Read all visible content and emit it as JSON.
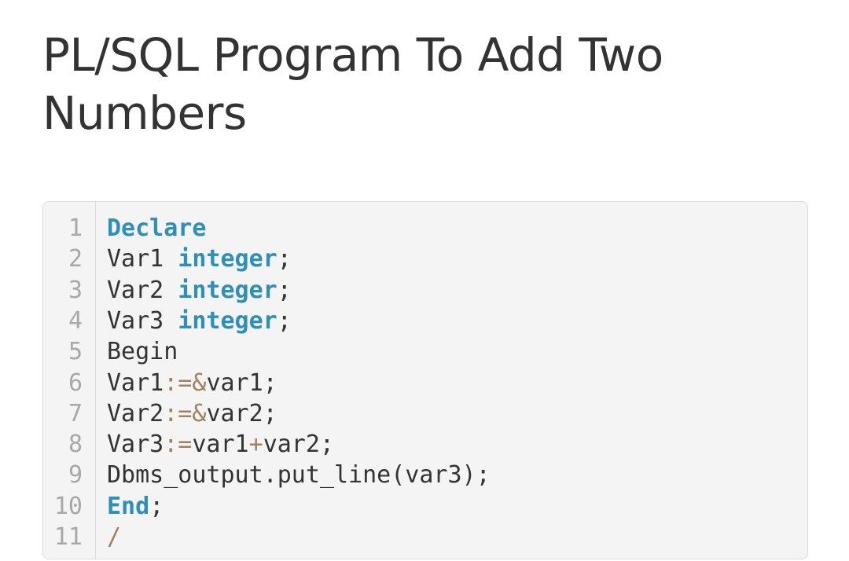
{
  "article": {
    "title_line1": "PL/SQL Program To Add Two",
    "title_line2": "Numbers"
  },
  "code_block": {
    "lines": [
      {
        "number": "1",
        "tokens": [
          {
            "text": "Declare",
            "type": "keyword"
          }
        ]
      },
      {
        "number": "2",
        "tokens": [
          {
            "text": "Var1 ",
            "type": "plain"
          },
          {
            "text": "integer",
            "type": "keyword"
          },
          {
            "text": ";",
            "type": "plain"
          }
        ]
      },
      {
        "number": "3",
        "tokens": [
          {
            "text": "Var2 ",
            "type": "plain"
          },
          {
            "text": "integer",
            "type": "keyword"
          },
          {
            "text": ";",
            "type": "plain"
          }
        ]
      },
      {
        "number": "4",
        "tokens": [
          {
            "text": "Var3 ",
            "type": "plain"
          },
          {
            "text": "integer",
            "type": "keyword"
          },
          {
            "text": ";",
            "type": "plain"
          }
        ]
      },
      {
        "number": "5",
        "tokens": [
          {
            "text": "Begin",
            "type": "plain"
          }
        ]
      },
      {
        "number": "6",
        "tokens": [
          {
            "text": "Var1",
            "type": "plain"
          },
          {
            "text": ":=&",
            "type": "operator"
          },
          {
            "text": "var1;",
            "type": "plain"
          }
        ]
      },
      {
        "number": "7",
        "tokens": [
          {
            "text": "Var2",
            "type": "plain"
          },
          {
            "text": ":=&",
            "type": "operator"
          },
          {
            "text": "var2;",
            "type": "plain"
          }
        ]
      },
      {
        "number": "8",
        "tokens": [
          {
            "text": "Var3",
            "type": "plain"
          },
          {
            "text": ":=",
            "type": "operator"
          },
          {
            "text": "var1",
            "type": "plain"
          },
          {
            "text": "+",
            "type": "operator"
          },
          {
            "text": "var2;",
            "type": "plain"
          }
        ]
      },
      {
        "number": "9",
        "tokens": [
          {
            "text": "Dbms_output.put_line(var3);",
            "type": "plain"
          }
        ]
      },
      {
        "number": "10",
        "tokens": [
          {
            "text": "End",
            "type": "keyword"
          },
          {
            "text": ";",
            "type": "plain"
          }
        ]
      },
      {
        "number": "11",
        "tokens": [
          {
            "text": "/",
            "type": "operator"
          }
        ]
      }
    ]
  },
  "colors": {
    "keyword": "#2e8fb8",
    "operator": "#a0825e",
    "plain": "#333333",
    "line_number": "#a8a8a8",
    "code_background": "#f4f4f4"
  }
}
